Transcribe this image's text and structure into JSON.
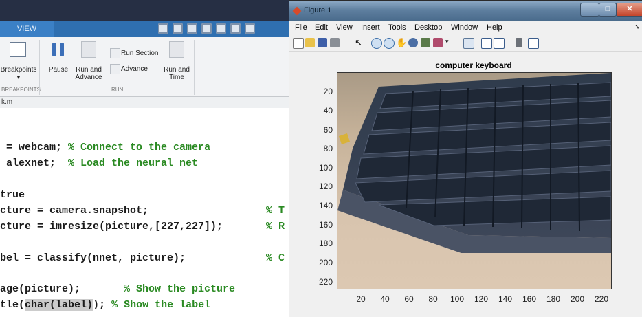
{
  "matlab": {
    "tab_view": "VIEW",
    "ribbon": {
      "breakpoints": "Breakpoints",
      "pause": "Pause",
      "run_and_advance": "Run and\nAdvance",
      "run_section": "Run Section",
      "advance": "Advance",
      "run_and_time": "Run and\nTime",
      "group_breakpoints": "BREAKPOINTS",
      "group_run": "RUN"
    },
    "path": "k.m",
    "code_lines": [
      {
        "code": " = webcam; ",
        "comment": "% Connect to the camera"
      },
      {
        "code": " alexnet;  ",
        "comment": "% Load the neural net"
      },
      {
        "code": "true",
        "comment": ""
      },
      {
        "code": "cture = camera.snapshot;",
        "comment": "% T"
      },
      {
        "code": "cture = imresize(picture,[227,227]);",
        "comment": "% R"
      },
      {
        "code": "bel = classify(nnet, picture);",
        "comment": "% C"
      },
      {
        "code": "age(picture);",
        "comment": "% Show the picture"
      },
      {
        "code_pre": "tle(",
        "code_hl": "char(label)",
        "code_post": "); ",
        "comment": "% Show the label"
      }
    ]
  },
  "figure": {
    "title": "Figure 1",
    "menu": [
      "File",
      "Edit",
      "View",
      "Insert",
      "Tools",
      "Desktop",
      "Window",
      "Help"
    ],
    "plot_title": "computer keyboard",
    "y_ticks": [
      "20",
      "40",
      "60",
      "80",
      "100",
      "120",
      "140",
      "160",
      "180",
      "200",
      "220"
    ],
    "x_ticks": [
      "20",
      "40",
      "60",
      "80",
      "100",
      "120",
      "140",
      "160",
      "180",
      "200",
      "220"
    ]
  }
}
